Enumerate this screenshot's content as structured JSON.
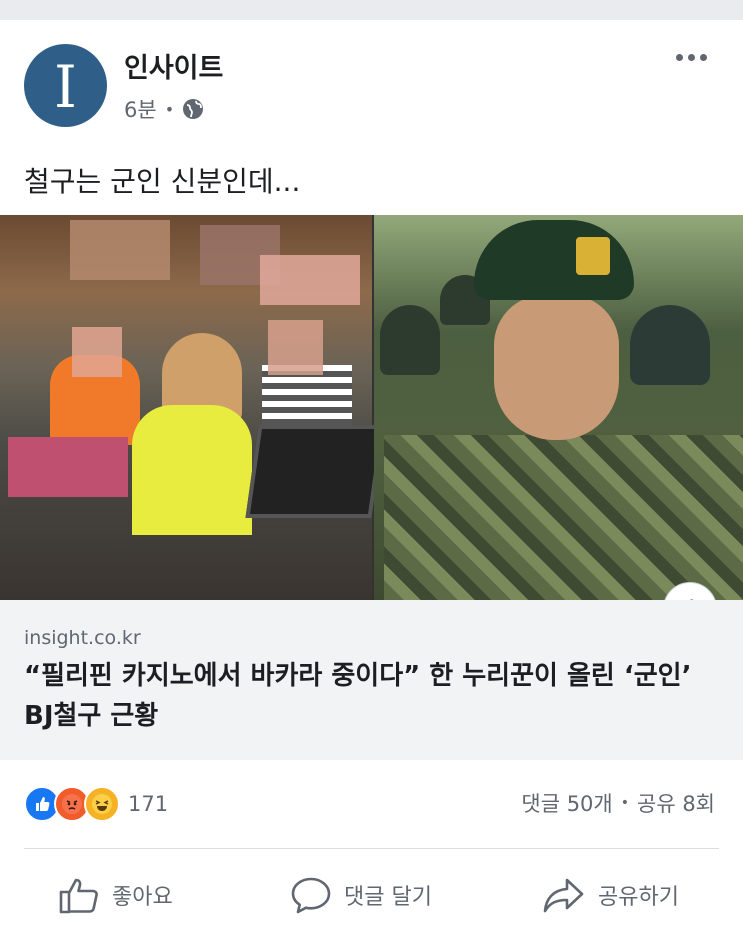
{
  "post": {
    "page_name": "인사이트",
    "avatar_letter": "I",
    "time": "6분",
    "separator": "•",
    "text": "철구는 군인 신분인데..."
  },
  "link_preview": {
    "domain": "insight.co.kr",
    "headline": "“필리핀 카지노에서 바카라 중이다” 한 누리꾼이 올린 ‘군인’ BJ철구 근황",
    "info_label": "i"
  },
  "reactions": {
    "count": "171",
    "types": [
      "like-icon",
      "angry-icon",
      "haha-icon"
    ],
    "comments": "댓글 50개",
    "separator": "•",
    "shares": "공유 8회"
  },
  "actions": {
    "like": "좋아요",
    "comment": "댓글 달기",
    "share": "공유하기"
  },
  "colors": {
    "avatar_bg": "#2f5f88",
    "like_blue": "#1877f2",
    "text_secondary": "#606770",
    "link_bg": "#f2f3f5"
  }
}
